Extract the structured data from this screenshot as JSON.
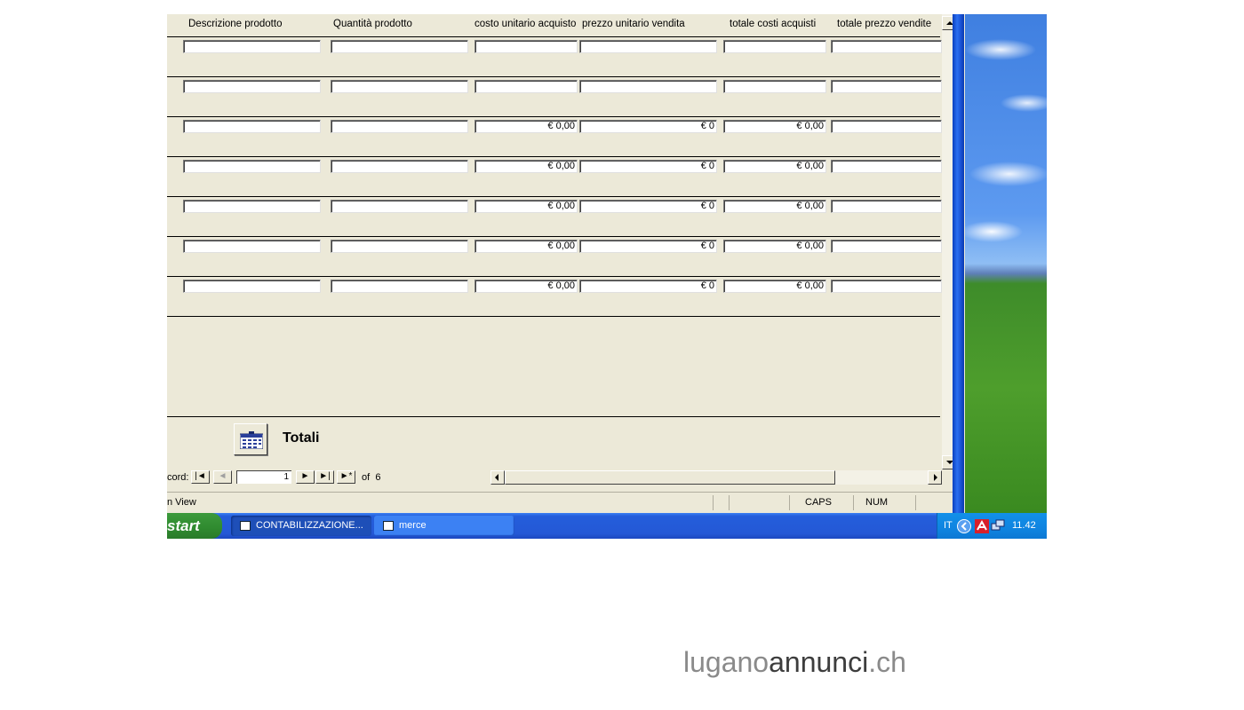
{
  "columns": [
    "Descrizione prodotto",
    "Quantità prodotto",
    "costo unitario acquisto",
    "prezzo unitario vendita",
    "totale costi acquisti",
    "totale prezzo vendite"
  ],
  "rows": [
    {
      "descrizione": "",
      "quantita": "",
      "costo": "",
      "prezzo": "",
      "totale_costi": "",
      "totale_prezzo": ""
    },
    {
      "descrizione": "",
      "quantita": "",
      "costo": "",
      "prezzo": "",
      "totale_costi": "",
      "totale_prezzo": ""
    },
    {
      "descrizione": "",
      "quantita": "",
      "costo": "€ 0,00",
      "prezzo": "€ 0",
      "totale_costi": "€ 0,00",
      "totale_prezzo": ""
    },
    {
      "descrizione": "",
      "quantita": "",
      "costo": "€ 0,00",
      "prezzo": "€ 0",
      "totale_costi": "€ 0,00",
      "totale_prezzo": ""
    },
    {
      "descrizione": "",
      "quantita": "",
      "costo": "€ 0,00",
      "prezzo": "€ 0",
      "totale_costi": "€ 0,00",
      "totale_prezzo": ""
    },
    {
      "descrizione": "",
      "quantita": "",
      "costo": "€ 0,00",
      "prezzo": "€ 0",
      "totale_costi": "€ 0,00",
      "totale_prezzo": ""
    },
    {
      "descrizione": "",
      "quantita": "",
      "costo": "€ 0,00",
      "prezzo": "€ 0",
      "totale_costi": "€ 0,00",
      "totale_prezzo": ""
    }
  ],
  "totals_button": {
    "label": "Totali",
    "icon": "calculator-icon"
  },
  "navigation": {
    "record_label": "cord:",
    "current_record": "1",
    "of_label": "of",
    "total_records": "6",
    "first": "|◄",
    "prev": "◄",
    "next": "►",
    "last": "►|",
    "new": "►*"
  },
  "status_bar": {
    "view": "n View",
    "caps": "CAPS",
    "num": "NUM"
  },
  "taskbar": {
    "start": "start",
    "tasks": [
      {
        "label": "CONTABILIZZAZIONE...",
        "icon": "access-database-icon",
        "active": true
      },
      {
        "label": "merce",
        "icon": "form-icon",
        "active": false
      }
    ],
    "tray": {
      "language": "IT",
      "time": "11.42"
    }
  },
  "watermark": {
    "part1": "lugano",
    "part2": "annunci",
    "part3": ".ch"
  },
  "colors": {
    "form_bg": "#ece9d8",
    "taskbar_blue": "#245edb",
    "start_green": "#2f8a2f",
    "tray_blue": "#0f84e0"
  }
}
